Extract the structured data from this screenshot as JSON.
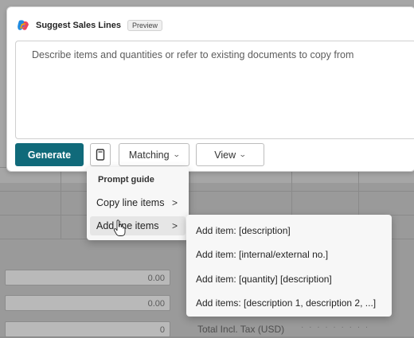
{
  "panel": {
    "title": "Suggest Sales Lines",
    "badge": "Preview",
    "prompt_placeholder": "Describe items and quantities or refer to existing documents to copy from"
  },
  "toolbar": {
    "generate_label": "Generate",
    "matching_label": "Matching",
    "view_label": "View"
  },
  "prompt_guide_menu": {
    "header": "Prompt guide",
    "items": [
      {
        "label": "Copy line items"
      },
      {
        "label": "Add line items"
      }
    ]
  },
  "add_line_items_submenu": {
    "items": [
      {
        "label": "Add item: [description]"
      },
      {
        "label": "Add item: [internal/external no.]"
      },
      {
        "label": "Add item: [quantity] [description]"
      },
      {
        "label": "Add items: [description 1, description 2, ...]"
      }
    ]
  },
  "background": {
    "fields": [
      "0.00",
      "0.00",
      "0"
    ],
    "total_label": "Total Incl. Tax (USD)"
  },
  "colors": {
    "accent": "#106a7a",
    "panel_bg": "#ffffff",
    "menu_bg": "#f7f7f7",
    "overlay": "#9a9a9a"
  }
}
